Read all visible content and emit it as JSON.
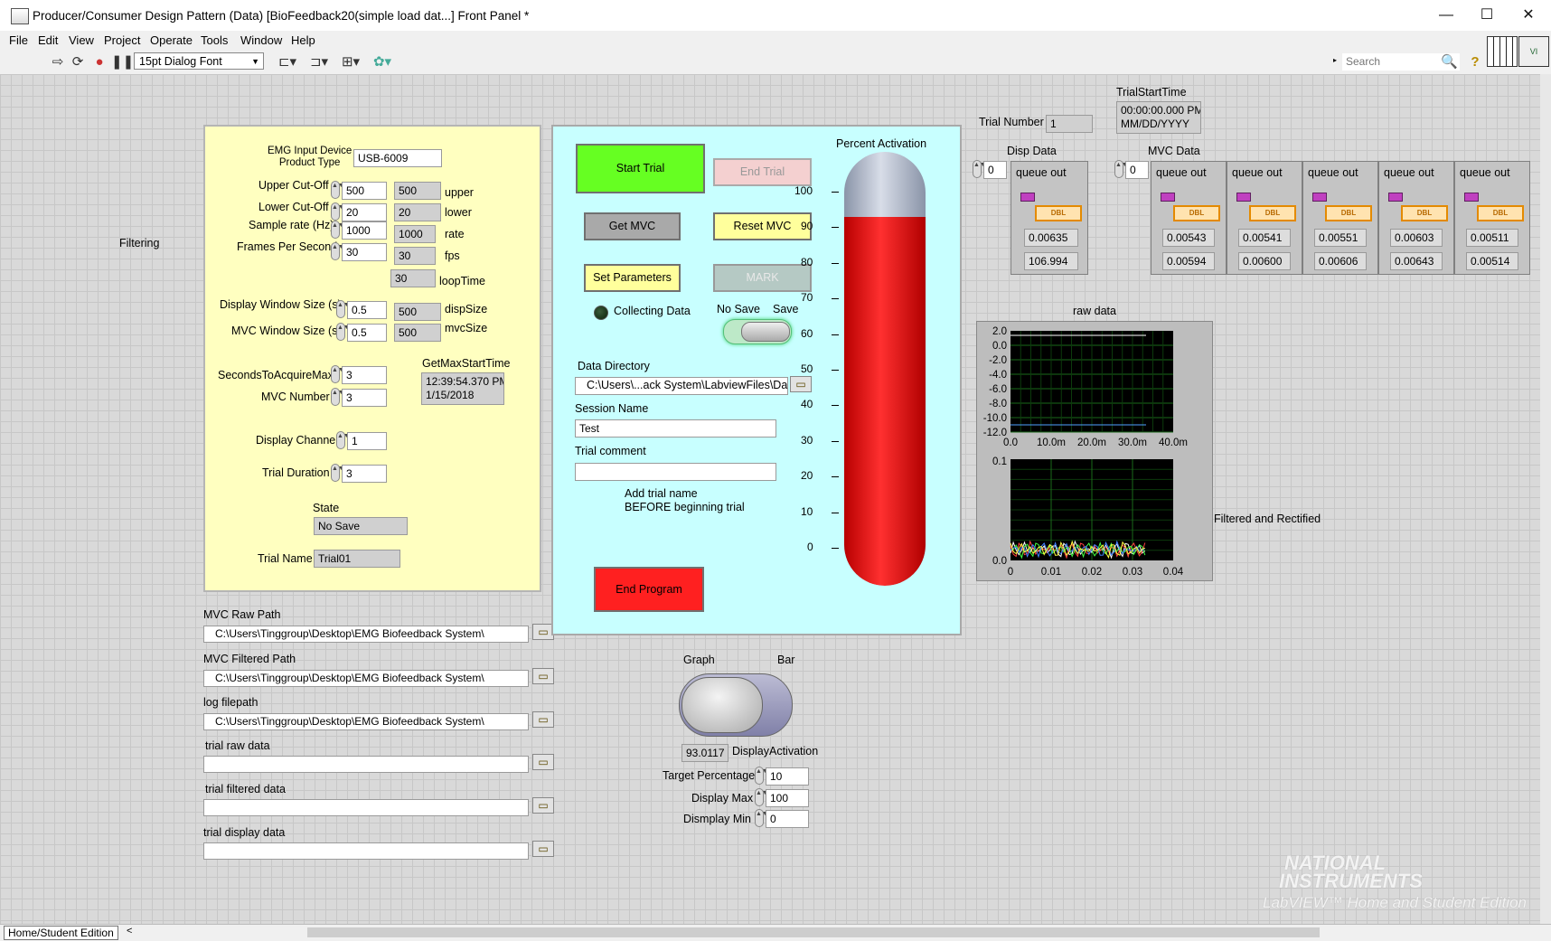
{
  "window": {
    "title": "Producer/Consumer Design Pattern (Data) [BioFeedback20(simple load dat...] Front Panel *",
    "minimize": "—",
    "maximize": "☐",
    "close": "✕"
  },
  "menu": [
    "File",
    "Edit",
    "View",
    "Project",
    "Operate",
    "Tools",
    "Window",
    "Help"
  ],
  "toolbar": {
    "font": "15pt Dialog Font",
    "search_placeholder": "Search"
  },
  "labels": {
    "filtering": "Filtering",
    "filtered_rectified": "Filtered and Rectified"
  },
  "settings": {
    "emg_device_label": "EMG Input Device\nProduct Type",
    "emg_device_value": "USB-6009",
    "upper_label": "Upper Cut-Off",
    "upper_value": "500",
    "upper_ind": "500",
    "upper_ind_label": "upper",
    "lower_label": "Lower Cut-Off",
    "lower_value": "20",
    "lower_ind": "20",
    "lower_ind_label": "lower",
    "rate_label": "Sample rate (Hz)",
    "rate_value": "1000",
    "rate_ind": "1000",
    "rate_ind_label": "rate",
    "fps_label": "Frames Per Second",
    "fps_value": "30",
    "fps_ind": "30",
    "fps_ind_label": "fps",
    "loop_ind": "30",
    "loop_label": "loopTime",
    "disp_label": "Display Window Size (s)",
    "disp_value": "0.5",
    "disp_ind": "500",
    "disp_ind_label": "dispSize",
    "mvcw_label": "MVC Window Size (s)",
    "mvcw_value": "0.5",
    "mvcw_ind": "500",
    "mvcw_ind_label": "mvcSize",
    "secs_label": "SecondsToAcquireMax",
    "secs_value": "3",
    "getmax_label": "GetMaxStartTime",
    "getmax_time": "12:39:54.370 PM",
    "getmax_date": "1/15/2018",
    "mvcnum_label": "MVC Number",
    "mvcnum_value": "3",
    "channel_label": "Display Channel",
    "channel_value": "1",
    "duration_label": "Trial Duration",
    "duration_value": "3",
    "state_label": "State",
    "state_value": "No Save",
    "trialname_label": "Trial Name",
    "trialname_value": "Trial01"
  },
  "paths": [
    {
      "label": "MVC Raw Path",
      "value": "C:\\Users\\Tinggroup\\Desktop\\EMG Biofeedback System\\"
    },
    {
      "label": "MVC Filtered Path",
      "value": "C:\\Users\\Tinggroup\\Desktop\\EMG Biofeedback System\\"
    },
    {
      "label": "log filepath",
      "value": "C:\\Users\\Tinggroup\\Desktop\\EMG Biofeedback System\\"
    },
    {
      "label": "trial raw data",
      "value": ""
    },
    {
      "label": "trial filtered data",
      "value": ""
    },
    {
      "label": "trial display data",
      "value": ""
    }
  ],
  "control_panel": {
    "start_trial": "Start Trial",
    "end_trial": "End Trial",
    "get_mvc": "Get MVC",
    "reset_mvc": "Reset MVC",
    "set_parameters": "Set Parameters",
    "mark": "MARK",
    "collecting_data": "Collecting Data",
    "no_save": "No Save",
    "save": "Save",
    "data_dir_label": "Data Directory",
    "data_dir_value": "C:\\Users\\...ack System\\LabviewFiles\\Data",
    "session_label": "Session Name",
    "session_value": "Test",
    "comment_label": "Trial comment",
    "comment_value": "",
    "note": "Add trial name\nBEFORE beginning trial",
    "end_program": "End Program",
    "thermo_title": "Percent Activation",
    "thermo_ticks": [
      "100",
      "90",
      "80",
      "70",
      "60",
      "50",
      "40",
      "30",
      "20",
      "10",
      "0"
    ],
    "thermo_level": 93.0117
  },
  "display_mode": {
    "graph": "Graph",
    "bar": "Bar",
    "activation_value": "93.0117",
    "activation_label": "DisplayActivation",
    "target_label": "Target Percentage",
    "target_value": "10",
    "max_label": "Display Max",
    "max_value": "100",
    "min_label": "Dismplay Min",
    "min_value": "0"
  },
  "trial": {
    "number_label": "Trial Number",
    "number_value": "1",
    "start_label": "TrialStartTime",
    "start_time": "00:00:00.000 PM",
    "start_date": "MM/DD/YYYY"
  },
  "disp_data": {
    "label": "Disp Data",
    "index": "0",
    "cluster_label": "queue out",
    "type": "DBL",
    "v1": "0.00635",
    "v2": "106.994"
  },
  "mvc_data": {
    "label": "MVC Data",
    "index": "0",
    "items": [
      {
        "label": "queue out",
        "type": "DBL",
        "v1": "0.00543",
        "v2": "0.00594"
      },
      {
        "label": "queue out",
        "type": "DBL",
        "v1": "0.00541",
        "v2": "0.00600"
      },
      {
        "label": "queue out",
        "type": "DBL",
        "v1": "0.00551",
        "v2": "0.00606"
      },
      {
        "label": "queue out",
        "type": "DBL",
        "v1": "0.00603",
        "v2": "0.00643"
      },
      {
        "label": "queue out",
        "type": "DBL",
        "v1": "0.00511",
        "v2": "0.00514"
      }
    ]
  },
  "raw_graph": {
    "title": "raw data",
    "yticks": [
      "2.0",
      "0.0",
      "-2.0",
      "-4.0",
      "-6.0",
      "-8.0",
      "-10.0",
      "-12.0"
    ],
    "xticks": [
      "0.0",
      "10.0m",
      "20.0m",
      "30.0m",
      "40.0m"
    ]
  },
  "filt_graph": {
    "yticks": [
      "0.1",
      "0.0"
    ],
    "xticks": [
      "0",
      "0.01",
      "0.02",
      "0.03",
      "0.04"
    ]
  },
  "watermark": {
    "line1": "NATIONAL",
    "line2": "INSTRUMENTS",
    "line3": "LabVIEW™ Home and Student Edition"
  },
  "status": {
    "edition": "Home/Student Edition"
  },
  "colors": {
    "start_green": "#66ff22",
    "end_red": "#ff2020",
    "panel_yellow": "#ffffc0",
    "panel_cyan": "#c8ffff"
  }
}
